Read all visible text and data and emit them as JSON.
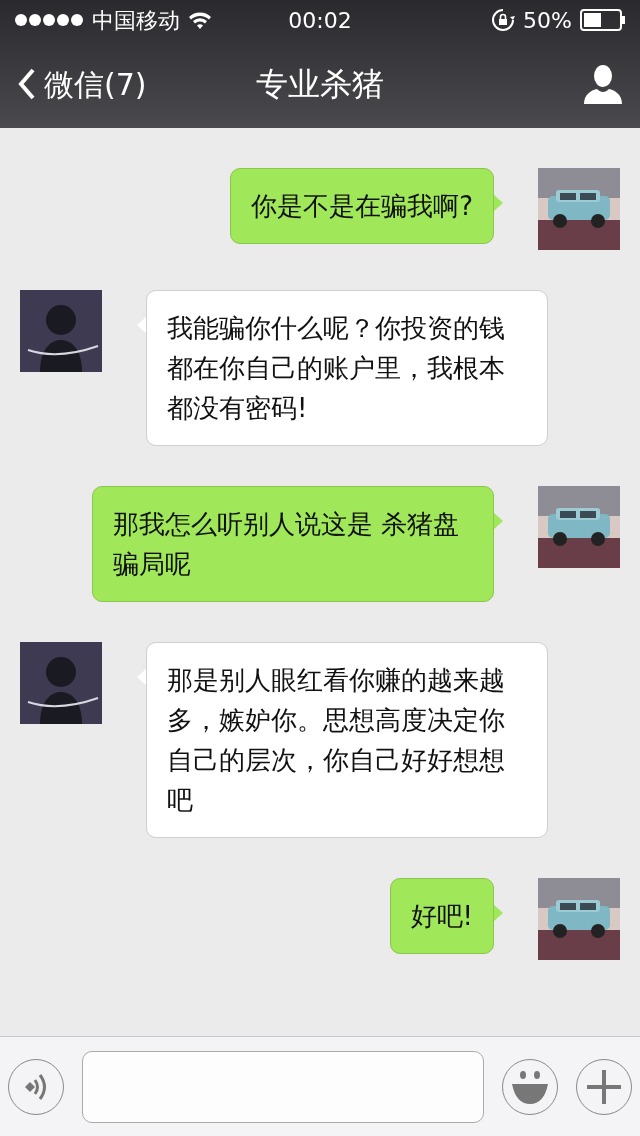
{
  "status_bar": {
    "carrier": "中国移动",
    "time": "00:02",
    "battery_text": "50%"
  },
  "nav": {
    "back_label": "微信(7)",
    "title": "专业杀猪"
  },
  "messages": [
    {
      "kind": "sent",
      "text": "你是不是在骗我啊?"
    },
    {
      "kind": "received",
      "text": "我能骗你什么呢？你投资的钱都在你自己的账户里，我根本都没有密码!"
    },
    {
      "kind": "sent",
      "text": "那我怎么听别人说这是 杀猪盘骗局呢"
    },
    {
      "kind": "received",
      "text": "那是别人眼红看你赚的越来越多，嫉妒你。思想高度决定你自己的层次，你自己好好想想吧"
    },
    {
      "kind": "sent",
      "text": "好吧!"
    }
  ]
}
